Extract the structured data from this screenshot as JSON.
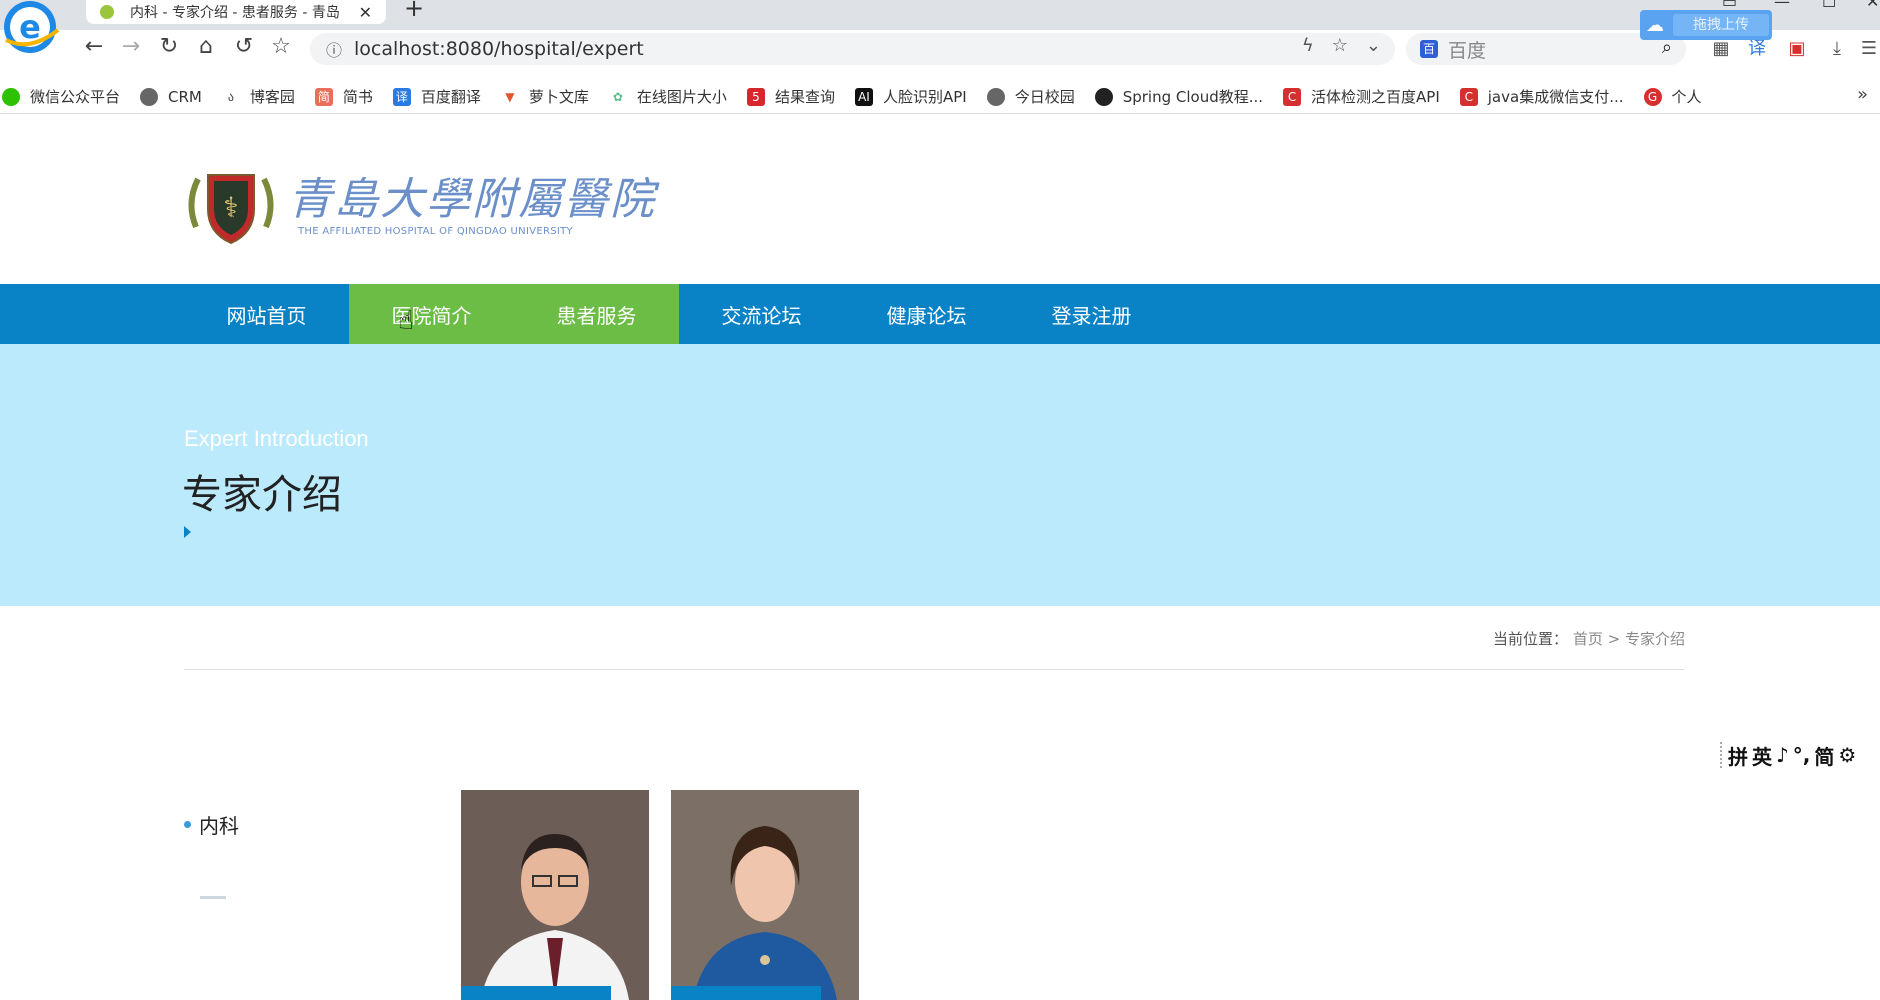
{
  "browser": {
    "tab_title": "内科 - 专家介绍 - 患者服务 - 青岛",
    "url": "localhost:8080/hospital/expert",
    "search_placeholder": "百度",
    "cloud_upload_label": "拖拽上传",
    "bookmarks": [
      {
        "label": "微信公众平台",
        "icon": "wechat-icon",
        "color": "#2dc100"
      },
      {
        "label": "CRM",
        "icon": "globe-icon",
        "color": "#666666"
      },
      {
        "label": "博客园",
        "icon": "cnblogs-icon",
        "color": "#444444"
      },
      {
        "label": "简书",
        "icon": "jianshu-icon",
        "color": "#ea6f5a"
      },
      {
        "label": "百度翻译",
        "icon": "translate-icon",
        "color": "#2a7ae2"
      },
      {
        "label": "萝卜文库",
        "icon": "carrot-icon",
        "color": "#e4572e"
      },
      {
        "label": "在线图片大小",
        "icon": "gear-icon",
        "color": "#5bbf8a"
      },
      {
        "label": "结果查询",
        "icon": "five-icon",
        "color": "#d8262d"
      },
      {
        "label": "人脸识别API",
        "icon": "ai-icon",
        "color": "#111111"
      },
      {
        "label": "今日校园",
        "icon": "globe-icon",
        "color": "#666666"
      },
      {
        "label": "Spring Cloud教程...",
        "icon": "github-icon",
        "color": "#222222"
      },
      {
        "label": "活体检测之百度API",
        "icon": "csdn-icon",
        "color": "#d62f2f"
      },
      {
        "label": "java集成微信支付...",
        "icon": "csdn-icon",
        "color": "#d62f2f"
      },
      {
        "label": "个人",
        "icon": "g-icon",
        "color": "#d62f2f"
      }
    ]
  },
  "site": {
    "logo_cn": "青島大學附屬醫院",
    "logo_en": "THE AFFILIATED HOSPITAL OF QINGDAO UNIVERSITY",
    "nav": [
      {
        "label": "网站首页",
        "active": false
      },
      {
        "label": "医院简介",
        "active": true
      },
      {
        "label": "患者服务",
        "active": true
      },
      {
        "label": "交流论坛",
        "active": false
      },
      {
        "label": "健康论坛",
        "active": false
      },
      {
        "label": "登录注册",
        "active": false
      }
    ],
    "accent_color": "#0a82c6",
    "active_color": "#6cbd45",
    "banner_color": "#bceafd"
  },
  "banner": {
    "subtitle_en": "Expert Introduction",
    "title_cn": "专家介绍"
  },
  "breadcrumb": {
    "prefix": "当前位置：",
    "home": "首页",
    "separator": ">",
    "current": "专家介绍"
  },
  "ime_bar": {
    "items": [
      "拼",
      "英",
      "♪",
      "°,",
      "简",
      "⚙"
    ]
  },
  "sidebar": {
    "category": "内科"
  },
  "experts": [
    {
      "photo": "male-doctor-photo"
    },
    {
      "photo": "female-doctor-photo"
    }
  ]
}
